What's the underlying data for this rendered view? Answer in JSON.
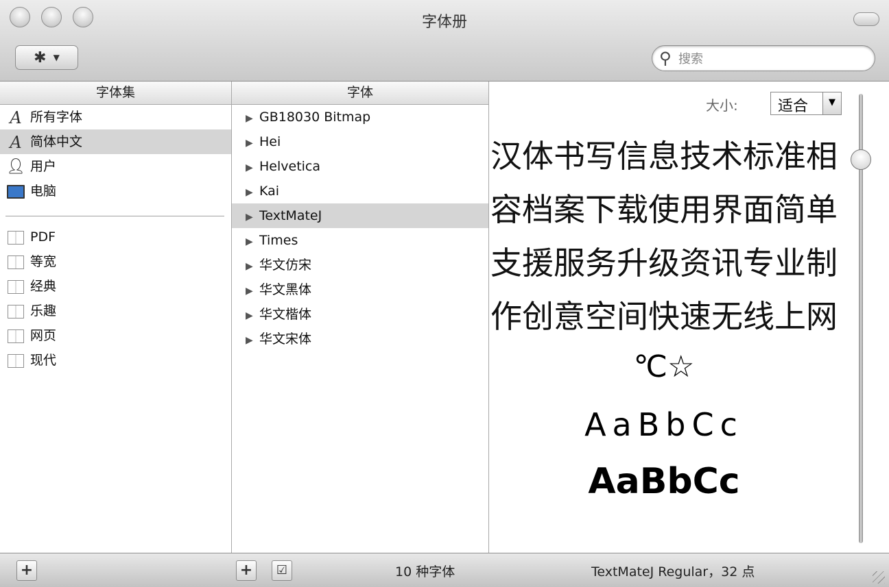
{
  "window": {
    "title": "字体册"
  },
  "toolbar": {
    "action_icon": "gear-icon",
    "search_placeholder": "搜索"
  },
  "collections": {
    "header": "字体集",
    "items": [
      {
        "label": "所有字体",
        "icon": "script-a-icon",
        "selected": false
      },
      {
        "label": "简体中文",
        "icon": "script-a-icon",
        "selected": true
      },
      {
        "label": "用户",
        "icon": "user-icon",
        "selected": false
      },
      {
        "label": "电脑",
        "icon": "computer-icon",
        "selected": false
      }
    ],
    "smart_items": [
      {
        "label": "PDF",
        "icon": "collection-icon"
      },
      {
        "label": "等宽",
        "icon": "collection-icon"
      },
      {
        "label": "经典",
        "icon": "collection-icon"
      },
      {
        "label": "乐趣",
        "icon": "collection-icon"
      },
      {
        "label": "网页",
        "icon": "collection-icon"
      },
      {
        "label": "现代",
        "icon": "collection-icon"
      }
    ]
  },
  "fonts": {
    "header": "字体",
    "items": [
      {
        "label": "GB18030 Bitmap",
        "selected": false
      },
      {
        "label": "Hei",
        "selected": false
      },
      {
        "label": "Helvetica",
        "selected": false
      },
      {
        "label": "Kai",
        "selected": false
      },
      {
        "label": "TextMateJ",
        "selected": true
      },
      {
        "label": "Times",
        "selected": false
      },
      {
        "label": "华文仿宋",
        "selected": false
      },
      {
        "label": "华文黑体",
        "selected": false
      },
      {
        "label": "华文楷体",
        "selected": false
      },
      {
        "label": "华文宋体",
        "selected": false
      }
    ]
  },
  "preview": {
    "size_label": "大小:",
    "size_value": "适合",
    "lines": [
      "汉体书写信息技术标准相",
      "容档案下载使用界面简单",
      "支援服务升级资讯专业制",
      "作创意空间快速无线上网"
    ],
    "symbols": "℃☆",
    "latin_regular": "AaBbCc",
    "latin_bold": "AaBbCc",
    "size_slider_level": 0.87
  },
  "status": {
    "font_count": "10 种字体",
    "selected_font": "TextMateJ Regular，32 点"
  }
}
